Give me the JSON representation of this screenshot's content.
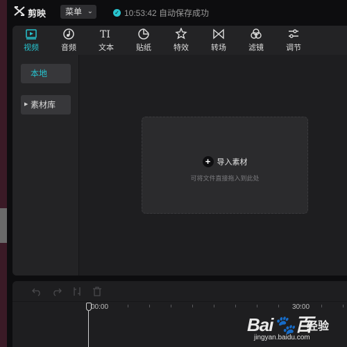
{
  "app": {
    "name": "剪映",
    "menu_label": "菜单",
    "save_status": "10:53:42 自动保存成功"
  },
  "toolbar": {
    "items": [
      {
        "label": "视频",
        "icon": "video-icon",
        "active": true
      },
      {
        "label": "音频",
        "icon": "audio-icon"
      },
      {
        "label": "文本",
        "icon": "text-icon"
      },
      {
        "label": "贴纸",
        "icon": "sticker-icon"
      },
      {
        "label": "特效",
        "icon": "effects-icon"
      },
      {
        "label": "转场",
        "icon": "transition-icon"
      },
      {
        "label": "滤镜",
        "icon": "filter-icon"
      },
      {
        "label": "调节",
        "icon": "adjust-icon"
      }
    ]
  },
  "sidebar": {
    "local": "本地",
    "library": "素材库"
  },
  "dropzone": {
    "import_label": "导入素材",
    "hint": "可将文件直接拖入到此处"
  },
  "timeline": {
    "time_start": "00:00",
    "time_mark": "30:00"
  },
  "watermark": {
    "logo": "Bai",
    "logo_tail": "百",
    "cn": "经验",
    "url": "jingyan.baidu.com"
  },
  "colors": {
    "accent": "#27c3cf",
    "panel": "#1e1e20",
    "background": "#0d0d0f"
  }
}
